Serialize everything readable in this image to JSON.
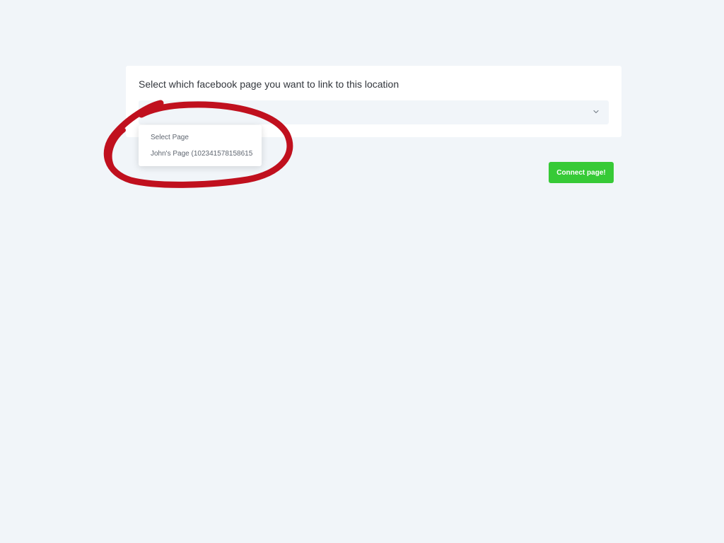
{
  "card": {
    "title": "Select which facebook page you want to link to this location"
  },
  "select": {
    "value": "",
    "icon": "chevron-down-icon"
  },
  "dropdown": {
    "options": [
      {
        "label": "Select Page"
      },
      {
        "label": "John's Page (102341578158615"
      }
    ]
  },
  "actions": {
    "connect_label": "Connect page!"
  },
  "colors": {
    "background": "#f1f5f9",
    "accent_button": "#37ca37",
    "annotation_marker": "#c0101e"
  }
}
